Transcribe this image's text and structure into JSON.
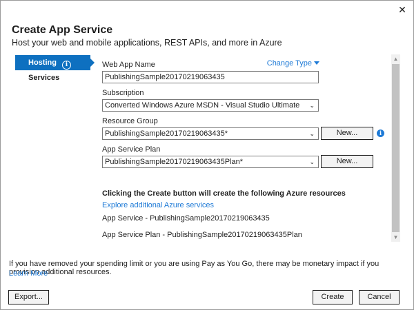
{
  "dialog": {
    "title": "Create App Service",
    "subtitle": "Host your web and mobile applications, REST APIs, and more in Azure",
    "close_glyph": "✕"
  },
  "sidebar": {
    "items": [
      {
        "label": "Hosting",
        "active": true
      },
      {
        "label": "Services",
        "active": false
      }
    ]
  },
  "form": {
    "change_type_label": "Change Type",
    "web_app_name": {
      "label": "Web App Name",
      "value": "PublishingSample20170219063435"
    },
    "subscription": {
      "label": "Subscription",
      "value": "Converted Windows Azure MSDN - Visual Studio Ultimate"
    },
    "resource_group": {
      "label": "Resource Group",
      "value": "PublishingSample20170219063435*",
      "new_button": "New..."
    },
    "app_service_plan": {
      "label": "App Service Plan",
      "value": "PublishingSample20170219063435Plan*",
      "new_button": "New..."
    },
    "resources_heading": "Clicking the Create button will create the following Azure resources",
    "explore_link": "Explore additional Azure services",
    "resources": [
      "App Service - PublishingSample20170219063435",
      "App Service Plan - PublishingSample20170219063435Plan"
    ]
  },
  "footer": {
    "note": "If you have removed your spending limit or you are using Pay as You Go, there may be monetary impact if you provision additional resources.",
    "learn_more": "Learn More",
    "export_button": "Export...",
    "create_button": "Create",
    "cancel_button": "Cancel"
  },
  "colors": {
    "accent": "#0e70c0",
    "link": "#1e7ad6"
  }
}
